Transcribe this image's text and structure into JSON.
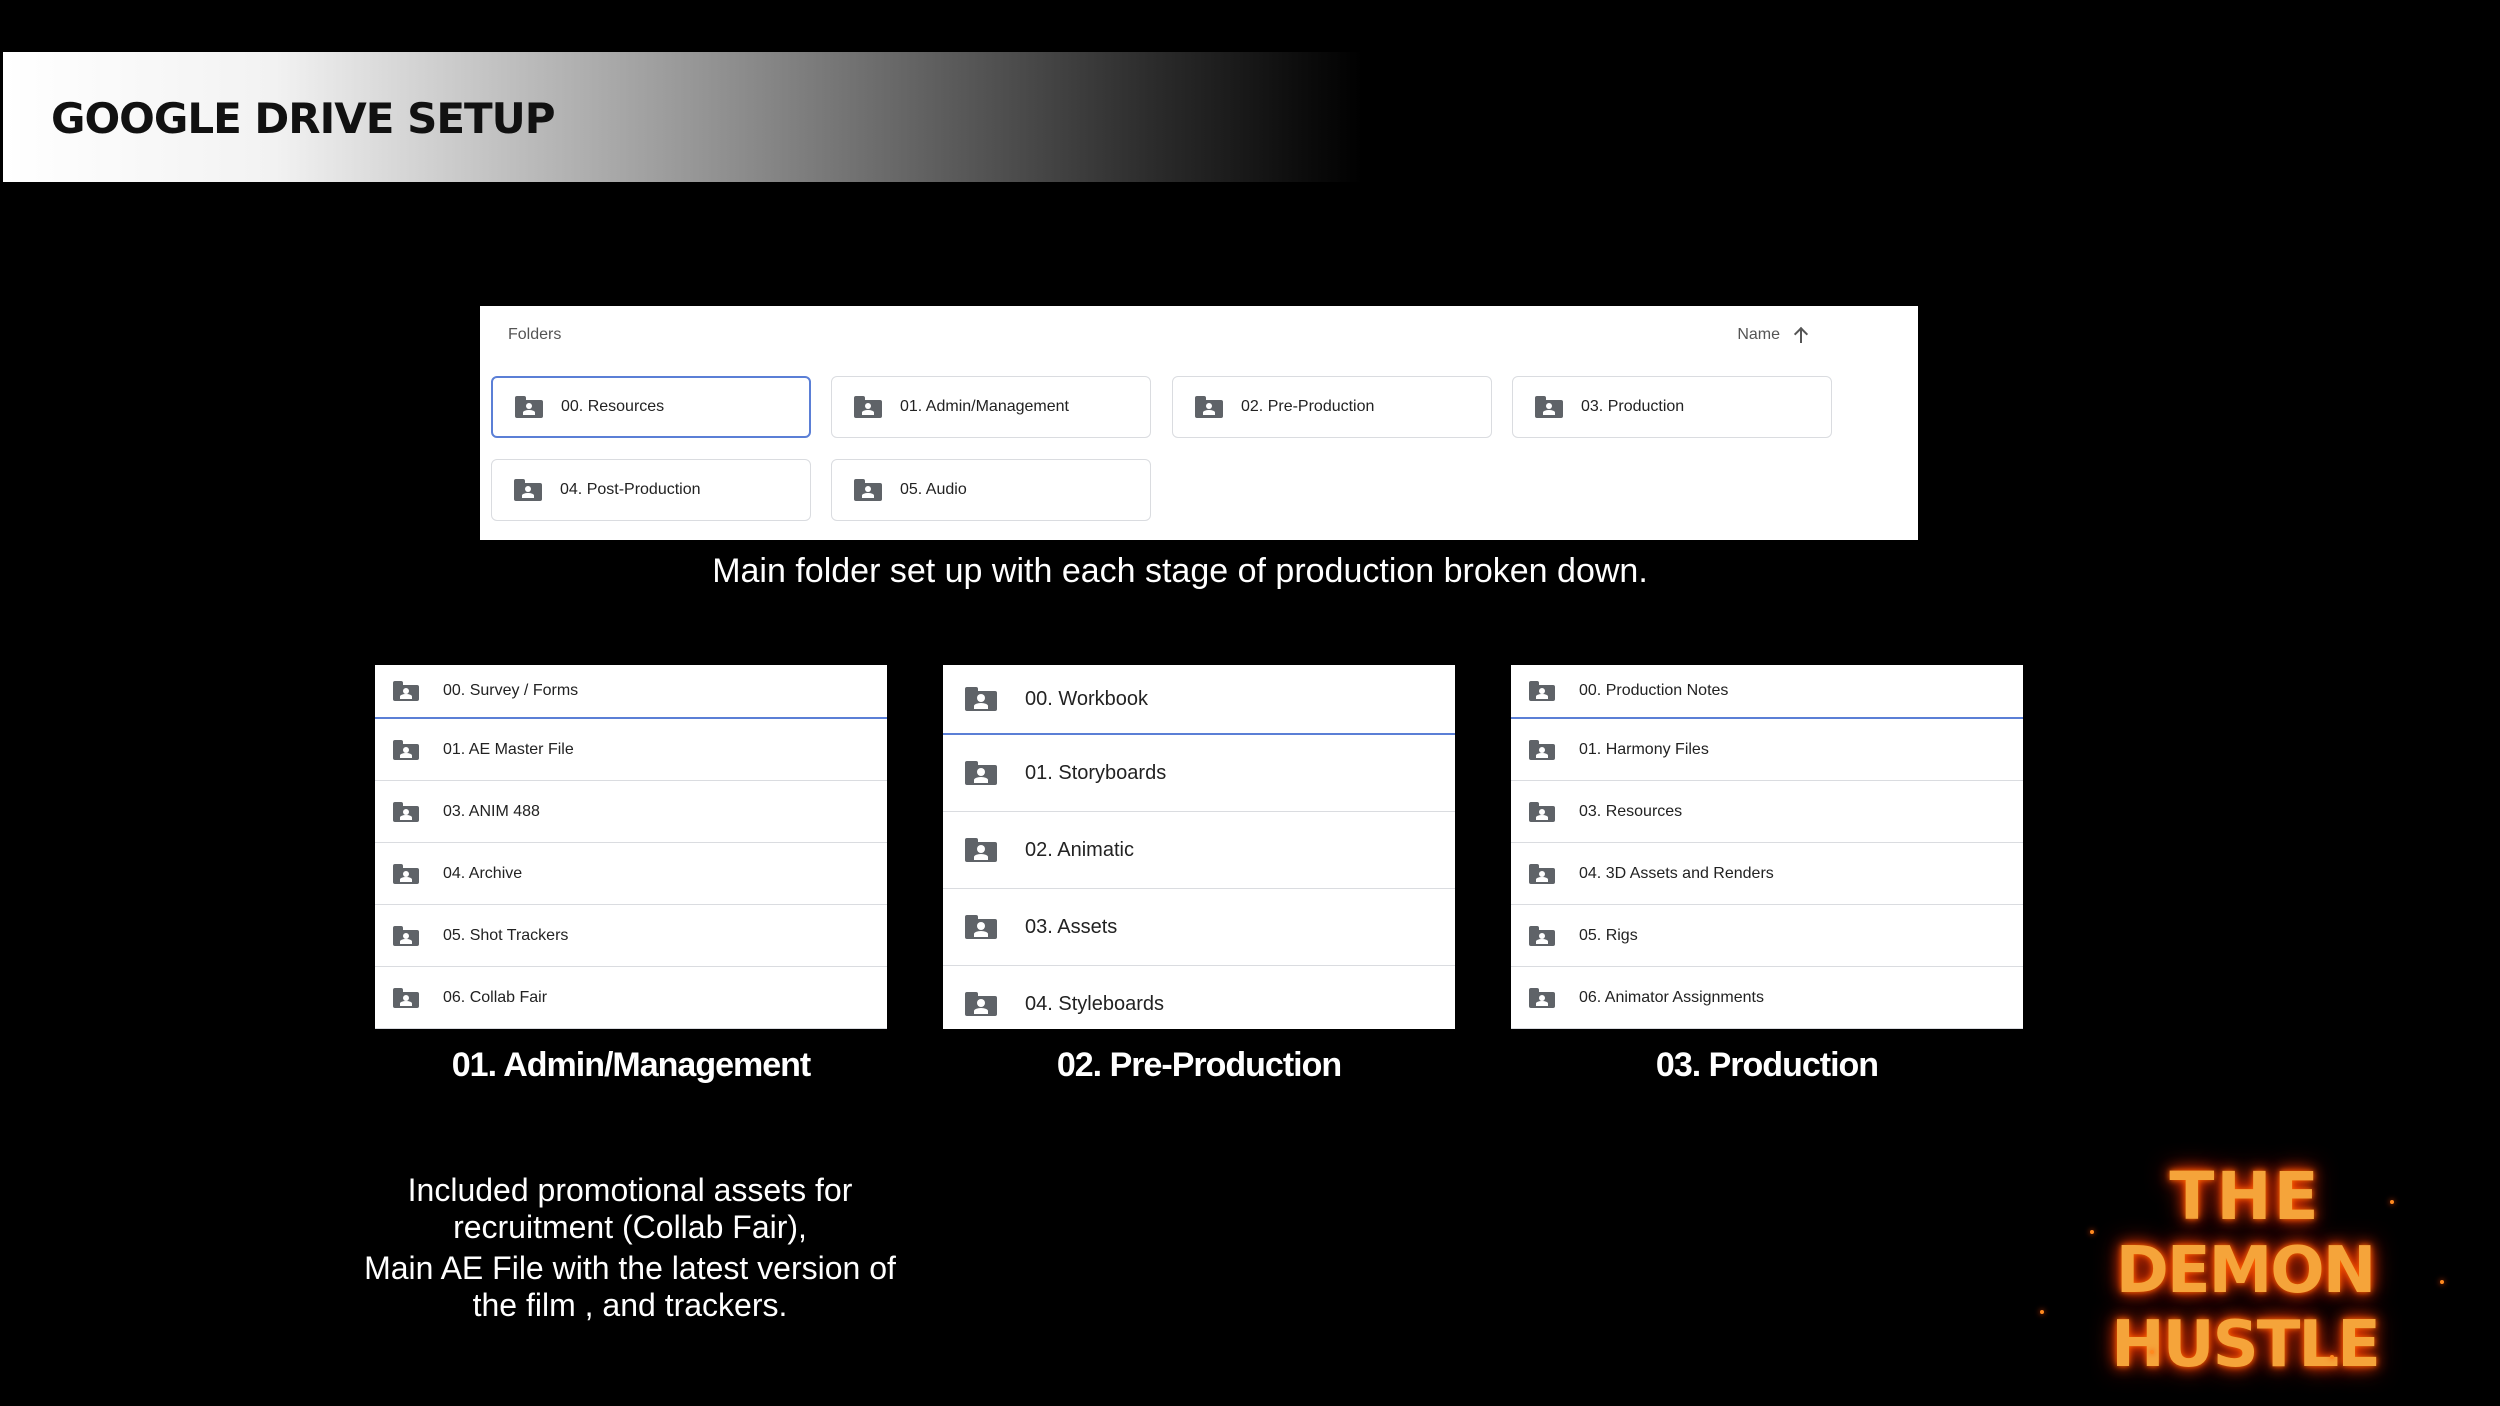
{
  "header": {
    "title": "GOOGLE DRIVE SETUP"
  },
  "drive": {
    "folders_label": "Folders",
    "sort_label": "Name",
    "folders": [
      {
        "label": "00. Resources"
      },
      {
        "label": "01. Admin/Management"
      },
      {
        "label": "02. Pre-Production"
      },
      {
        "label": "03. Production"
      },
      {
        "label": "04. Post-Production"
      },
      {
        "label": "05. Audio"
      }
    ]
  },
  "main_caption": "Main folder set up with each stage of production broken down.",
  "lists": [
    {
      "title": "01. Admin/Management",
      "items": [
        "00. Survey / Forms",
        "01. AE Master File",
        "03. ANIM 488",
        "04. Archive",
        "05. Shot Trackers",
        "06. Collab Fair"
      ]
    },
    {
      "title": "02. Pre-Production",
      "items": [
        "00. Workbook",
        "01. Storyboards",
        "02. Animatic",
        "03. Assets",
        "04. Styleboards"
      ]
    },
    {
      "title": "03. Production",
      "items": [
        "00. Production Notes",
        "01. Harmony Files",
        "03. Resources",
        "04. 3D Assets and Renders",
        "05. Rigs",
        "06. Animator Assignments"
      ]
    }
  ],
  "description": {
    "line1": "Included promotional assets for",
    "line2": "recruitment (Collab Fair),",
    "line3": "Main AE File with the latest version of",
    "line4": "the film , and trackers."
  },
  "logo": {
    "line1": "THE",
    "line2": "DEMON HUSTLE"
  }
}
